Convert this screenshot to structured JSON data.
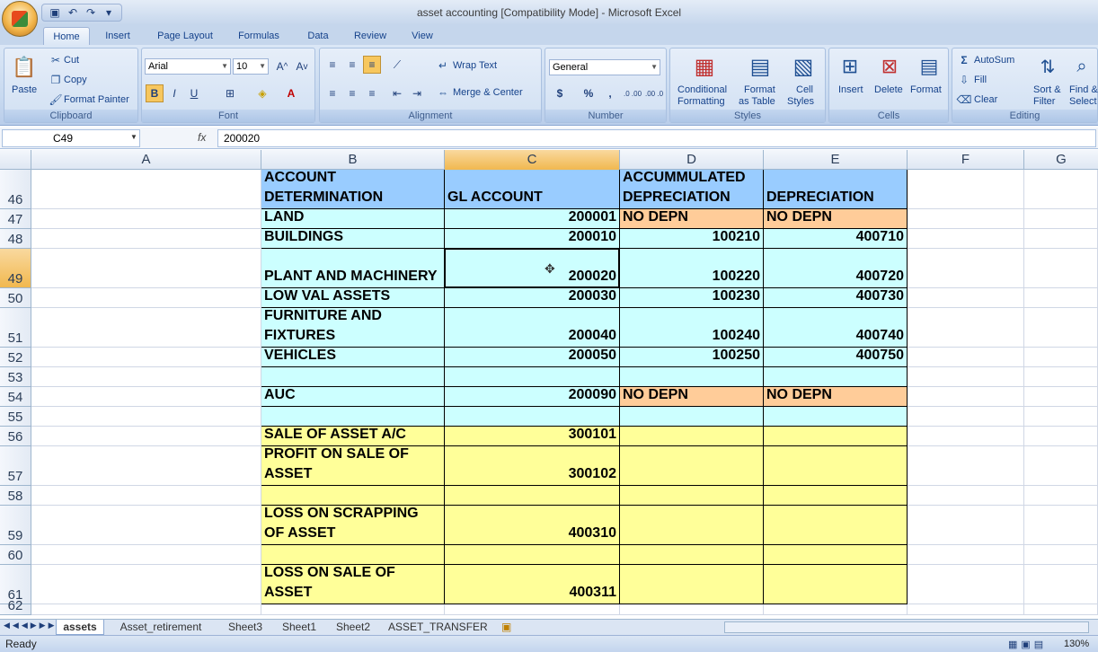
{
  "window": {
    "title": "asset accounting  [Compatibility Mode] - Microsoft Excel"
  },
  "qat": {
    "save_icon": "save-icon",
    "undo_icon": "undo-icon",
    "redo_icon": "redo-icon"
  },
  "tabs": [
    "Home",
    "Insert",
    "Page Layout",
    "Formulas",
    "Data",
    "Review",
    "View"
  ],
  "ribbon": {
    "clipboard": {
      "paste": "Paste",
      "cut": "Cut",
      "copy": "Copy",
      "format_painter": "Format Painter",
      "label": "Clipboard"
    },
    "font": {
      "name": "Arial",
      "size": "10",
      "label": "Font",
      "bold": "B",
      "italic": "I",
      "underline": "U"
    },
    "alignment": {
      "wrap_text": "Wrap Text",
      "merge_center": "Merge & Center",
      "label": "Alignment"
    },
    "number": {
      "format": "General",
      "currency": "$",
      "percent": "%",
      "comma": ",",
      "inc": ".0 .00",
      "dec": ".00 .0",
      "label": "Number"
    },
    "styles": {
      "conditional": "Conditional",
      "conditional2": "Formatting",
      "format_table": "Format",
      "format_table2": "as Table",
      "cell": "Cell",
      "cell2": "Styles",
      "label": "Styles"
    },
    "cells": {
      "insert": "Insert",
      "delete": "Delete",
      "format": "Format",
      "label": "Cells"
    },
    "editing": {
      "autosum": "AutoSum",
      "fill": "Fill",
      "clear": "Clear",
      "sort": "Sort &",
      "sort2": "Filter",
      "find": "Find &",
      "find2": "Select",
      "label": "Editing"
    }
  },
  "formula_bar": {
    "name_box": "C49",
    "fx": "fx",
    "content": "200020"
  },
  "columns": [
    "A",
    "B",
    "C",
    "D",
    "E",
    "F",
    "G"
  ],
  "rows": [
    {
      "num": "46",
      "b": [
        "ACCOUNT",
        "DETERMINATION"
      ],
      "c": "GL ACCOUNT",
      "d": [
        "ACCUMMULATED",
        "DEPRECIATION"
      ],
      "e": "DEPRECIATION"
    },
    {
      "num": "47",
      "b": [
        "LAND"
      ],
      "c": "200001",
      "d": [
        "NO DEPN"
      ],
      "e": "NO DEPN"
    },
    {
      "num": "48",
      "b": [
        "BUILDINGS"
      ],
      "c": "200010",
      "d": [
        "100210"
      ],
      "e": "400710"
    },
    {
      "num": "49",
      "b": [
        "PLANT AND MACHINERY"
      ],
      "c": "200020",
      "d": [
        "100220"
      ],
      "e": "400720"
    },
    {
      "num": "50",
      "b": [
        "LOW VAL ASSETS"
      ],
      "c": "200030",
      "d": [
        "100230"
      ],
      "e": "400730"
    },
    {
      "num": "51",
      "b": [
        "FURNITURE AND",
        "FIXTURES"
      ],
      "c": "200040",
      "d": [
        "100240"
      ],
      "e": "400740"
    },
    {
      "num": "52",
      "b": [
        "VEHICLES"
      ],
      "c": "200050",
      "d": [
        "100250"
      ],
      "e": "400750"
    },
    {
      "num": "53",
      "b": [
        ""
      ],
      "c": "",
      "d": [
        ""
      ],
      "e": ""
    },
    {
      "num": "54",
      "b": [
        "AUC"
      ],
      "c": "200090",
      "d": [
        "NO DEPN"
      ],
      "e": "NO DEPN"
    },
    {
      "num": "55",
      "b": [
        ""
      ],
      "c": "",
      "d": [
        ""
      ],
      "e": ""
    },
    {
      "num": "56",
      "b": [
        "SALE OF ASSET A/C"
      ],
      "c": "300101",
      "d": [
        ""
      ],
      "e": ""
    },
    {
      "num": "57",
      "b": [
        "PROFIT ON SALE OF",
        "ASSET"
      ],
      "c": "300102",
      "d": [
        ""
      ],
      "e": ""
    },
    {
      "num": "58",
      "b": [
        ""
      ],
      "c": "",
      "d": [
        ""
      ],
      "e": ""
    },
    {
      "num": "59",
      "b": [
        "LOSS ON SCRAPPING",
        "OF ASSET"
      ],
      "c": "400310",
      "d": [
        ""
      ],
      "e": ""
    },
    {
      "num": "60",
      "b": [
        ""
      ],
      "c": "",
      "d": [
        ""
      ],
      "e": ""
    },
    {
      "num": "61",
      "b": [
        "LOSS ON SALE OF",
        "ASSET"
      ],
      "c": "400311",
      "d": [
        ""
      ],
      "e": ""
    },
    {
      "num": "62",
      "b": [
        ""
      ],
      "c": "",
      "d": [
        ""
      ],
      "e": ""
    }
  ],
  "sheets": [
    "assets",
    "Asset_retirement",
    "Sheet3",
    "Sheet1",
    "Sheet2",
    "ASSET_TRANSFER"
  ],
  "status": {
    "ready": "Ready",
    "zoom": "130%"
  }
}
